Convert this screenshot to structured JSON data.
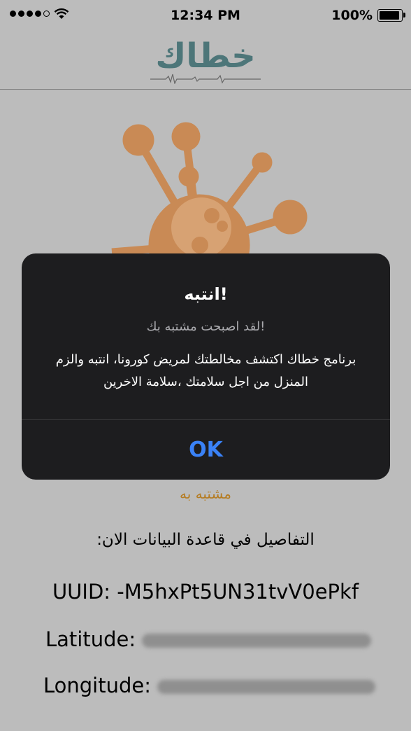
{
  "status_bar": {
    "time": "12:34 PM",
    "battery": "100%",
    "battery_level": 1.0,
    "signal_bars_filled": 4,
    "signal_bars_total": 5
  },
  "header": {
    "logo_text": "خطاك"
  },
  "dialog": {
    "title": "!انتبه",
    "subtitle": "!لقد اصبحت مشتبه بك",
    "body": "برنامج خطاك اكتشف مخالطتك لمريض كورونا، انتبه والزم المنزل من اجل سلامتك ،سلامة الاخرين",
    "ok_label": "OK"
  },
  "main": {
    "status_label": "مشتبه به",
    "details_label": "التفاصيل في قاعدة البيانات الان:",
    "uuid_label": "UUID: -M5hxPt5UN31tvV0ePkf",
    "latitude_label": "Latitude:",
    "longitude_label": "Longitude:"
  },
  "colors": {
    "background": "#bcbcbc",
    "logo": "#4d7679",
    "virus": "#c98a55",
    "dialog_bg": "#1d1d1f",
    "ok_button": "#3a82f7",
    "status_label": "#b57c22"
  },
  "icons": [
    "signal-icon",
    "wifi-icon",
    "battery-icon",
    "virus-icon",
    "heartbeat-line-icon"
  ]
}
